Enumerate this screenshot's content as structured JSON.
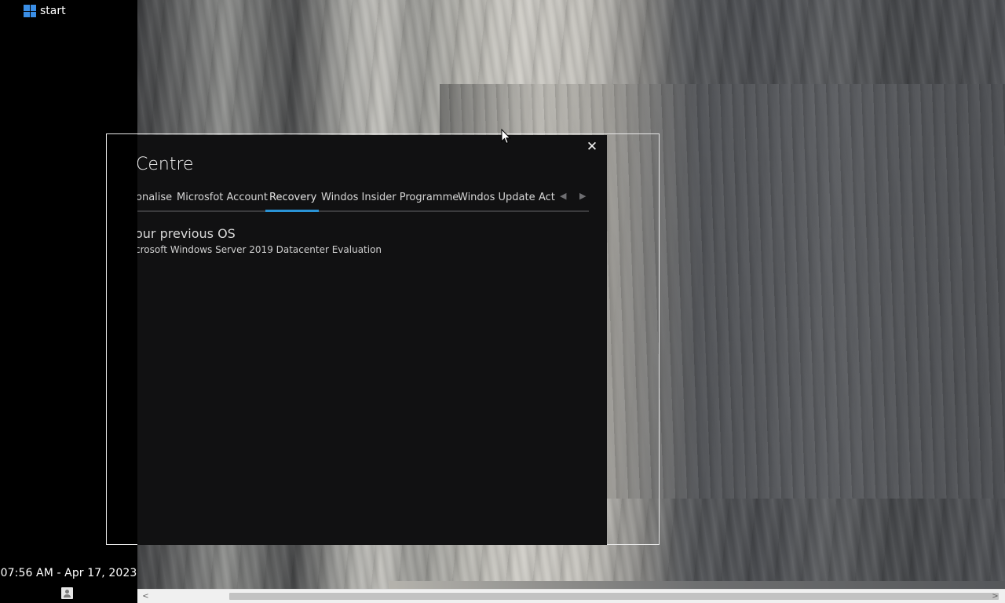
{
  "taskbar": {
    "start_label": "start",
    "clock": "07:56 AM - Apr 17, 2023",
    "user_icon": "user-icon"
  },
  "window": {
    "title": "Centre",
    "close_glyph": "✕",
    "tabs": [
      {
        "label": "onalise"
      },
      {
        "label": "Microsfot Account"
      },
      {
        "label": "Recovery"
      },
      {
        "label": "Windos Insider Programme"
      },
      {
        "label": "Windos Update"
      },
      {
        "label": "Acti"
      }
    ],
    "active_tab": "Recovery",
    "tab_prev_glyph": "◀",
    "tab_next_glyph": "▶",
    "section": {
      "heading": "our previous OS",
      "value": "crosoft Windows Server 2019 Datacenter Evaluation"
    }
  },
  "scrollbar": {
    "left_glyph": "<",
    "right_glyph": ">"
  },
  "colors": {
    "accent": "#2a93d5",
    "window_bg": "#111112",
    "taskbar_bg": "#000000",
    "windows_logo": "#3a8ee6"
  }
}
